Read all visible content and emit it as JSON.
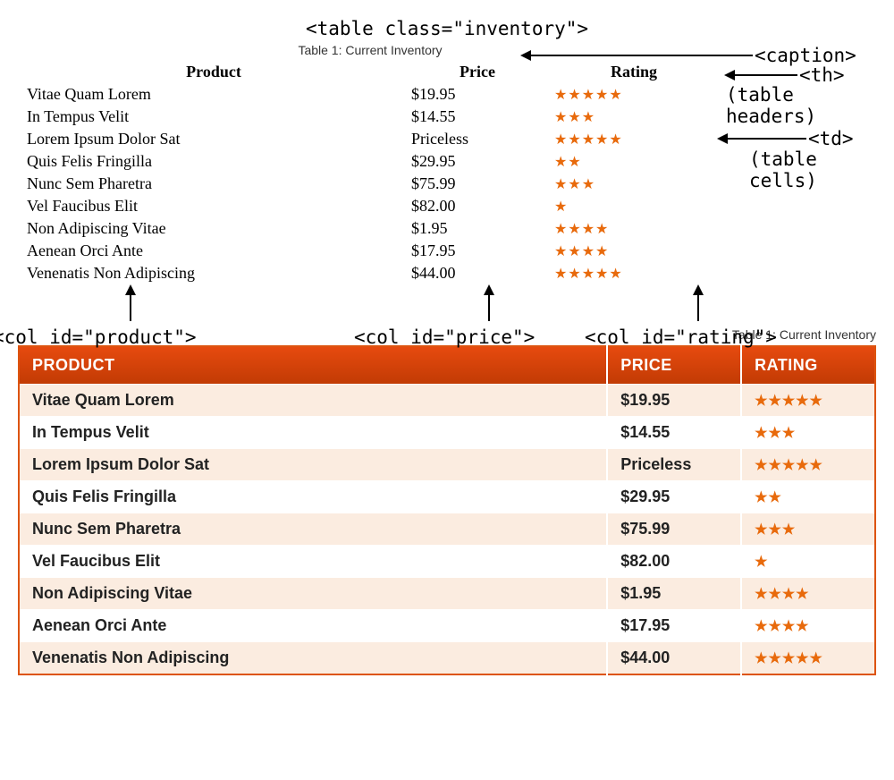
{
  "annotations": {
    "table_tag": "<table class=\"inventory\">",
    "caption_tag": "<caption>",
    "th_tag": "<th>",
    "th_note": "(table headers)",
    "td_tag": "<td>",
    "td_note": "(table cells)",
    "col_product": "<col id=\"product\">",
    "col_price": "<col id=\"price\">",
    "col_rating": "<col id=\"rating\">"
  },
  "caption": "Table 1: Current Inventory",
  "headers": {
    "product": "Product",
    "price": "Price",
    "rating": "Rating"
  },
  "styled_headers": {
    "product": "PRODUCT",
    "price": "PRICE",
    "rating": "RATING"
  },
  "rows": [
    {
      "product": "Vitae Quam Lorem",
      "price": "$19.95",
      "rating": 5
    },
    {
      "product": "In Tempus Velit",
      "price": "$14.55",
      "rating": 3
    },
    {
      "product": "Lorem Ipsum Dolor Sat",
      "price": "Priceless",
      "rating": 5
    },
    {
      "product": "Quis Felis Fringilla",
      "price": "$29.95",
      "rating": 2
    },
    {
      "product": "Nunc Sem Pharetra",
      "price": "$75.99",
      "rating": 3
    },
    {
      "product": "Vel Faucibus Elit",
      "price": "$82.00",
      "rating": 1
    },
    {
      "product": "Non Adipiscing Vitae",
      "price": "$1.95",
      "rating": 4
    },
    {
      "product": "Aenean Orci Ante",
      "price": "$17.95",
      "rating": 4
    },
    {
      "product": "Venenatis Non Adipiscing",
      "price": "$44.00",
      "rating": 5
    }
  ],
  "colors": {
    "star": "#e86a0c",
    "header_bg": "#cc3300",
    "stripe": "#fbece0"
  }
}
